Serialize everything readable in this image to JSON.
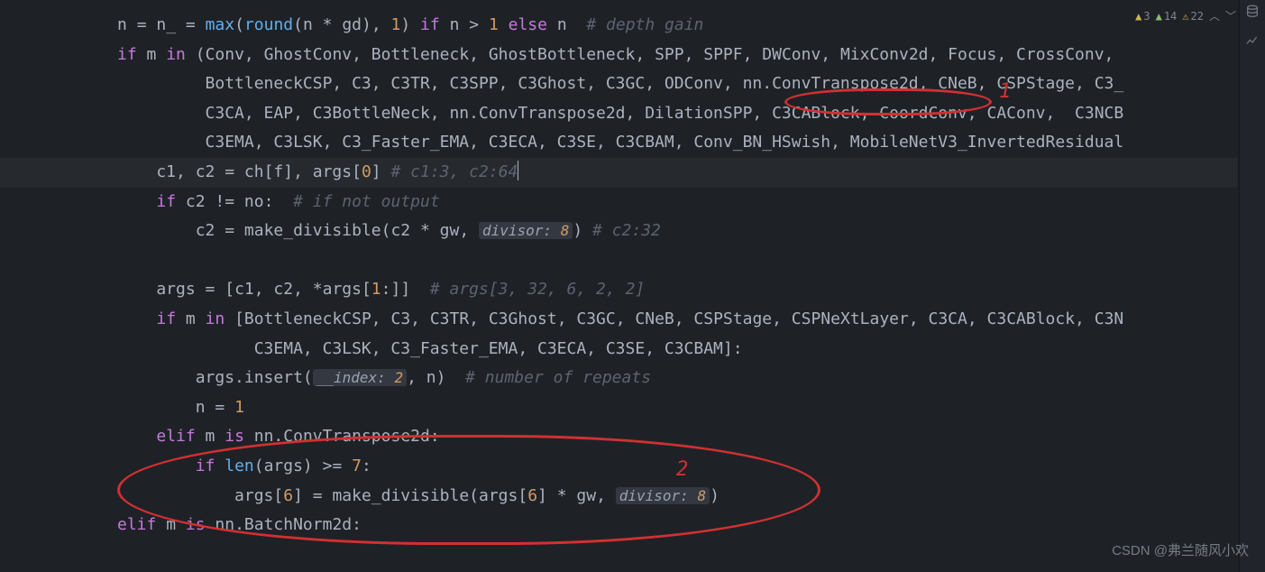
{
  "badges": {
    "err": "3",
    "warn": "14",
    "weak": "22"
  },
  "code": {
    "l1_a": "n ",
    "l1_b": "=",
    "l1_c": " n_ ",
    "l1_d": "=",
    "l1_e": " ",
    "l1_f": "max",
    "l1_g": "(",
    "l1_h": "round",
    "l1_i": "(n ",
    "l1_j": "*",
    "l1_k": " gd), ",
    "l1_l": "1",
    "l1_m": ") ",
    "l1_n": "if",
    "l1_o": " n ",
    "l1_p": ">",
    "l1_q": " ",
    "l1_r": "1",
    "l1_s": " ",
    "l1_t": "else",
    "l1_u": " n  ",
    "l1_v": "# depth gain",
    "l2_a": "if",
    "l2_b": " m ",
    "l2_c": "in",
    "l2_d": " (Conv, GhostConv, Bottleneck, GhostBottleneck, SPP, SPPF, DWConv, MixConv2d, Focus, CrossConv,",
    "l3_a": "         BottleneckCSP, C3, C3TR, C3SPP, C3Ghost, C3GC, ODConv, nn.ConvTranspose2d, CNeB, CSPStage, C3_",
    "l4_a": "         C3CA, EAP, C3BottleNeck, nn.ConvTranspose2d, DilationSPP, C3CABlock, CoordConv, CAConv,  C3NCB",
    "l5_a": "         C3EMA, C3LSK, C3_Faster_EMA, C3ECA, C3SE, C3CBAM, Conv_BN_HSwish, MobileNetV3_InvertedResidual",
    "l6_a": "    c1, c2 ",
    "l6_b": "=",
    "l6_c": " ch[f], args[",
    "l6_d": "0",
    "l6_e": "] ",
    "l6_f": "# c1:3, c2:64",
    "l7_a": "    ",
    "l7_b": "if",
    "l7_c": " c2 ",
    "l7_d": "!=",
    "l7_e": " no:  ",
    "l7_f": "# if not output",
    "l8_a": "        c2 ",
    "l8_b": "=",
    "l8_c": " make_divisible(c2 ",
    "l8_d": "*",
    "l8_e": " gw, ",
    "l8_hint": "divisor: ",
    "l8_hn": "8",
    "l8_f": ") ",
    "l8_g": "# c2:32",
    "l9": "",
    "l10_a": "    args ",
    "l10_b": "=",
    "l10_c": " [c1, c2, ",
    "l10_d": "*",
    "l10_e": "args[",
    "l10_f": "1",
    "l10_g": ":]]  ",
    "l10_h": "# args[3, 32, 6, 2, 2]",
    "l11_a": "    ",
    "l11_b": "if",
    "l11_c": " m ",
    "l11_d": "in",
    "l11_e": " [BottleneckCSP, C3, C3TR, C3Ghost, C3GC, CNeB, CSPStage, CSPNeXtLayer, C3CA, C3CABlock, C3N",
    "l12_a": "              C3EMA, C3LSK, C3_Faster_EMA, C3ECA, C3SE, C3CBAM]:",
    "l13_a": "        args.insert(",
    "l13_hint": "__index: ",
    "l13_hn": "2",
    "l13_b": ", n)  ",
    "l13_c": "# number of repeats",
    "l14_a": "        n ",
    "l14_b": "=",
    "l14_c": " ",
    "l14_d": "1",
    "l15_a": "    ",
    "l15_b": "elif",
    "l15_c": " m ",
    "l15_d": "is",
    "l15_e": " nn.ConvTranspose2d:",
    "l16_a": "        ",
    "l16_b": "if",
    "l16_c": " ",
    "l16_d": "len",
    "l16_e": "(args) ",
    "l16_f": ">=",
    "l16_g": " ",
    "l16_h": "7",
    "l16_i": ":",
    "l17_a": "            args[",
    "l17_b": "6",
    "l17_c": "] ",
    "l17_d": "=",
    "l17_e": " make_divisible(args[",
    "l17_f": "6",
    "l17_g": "] ",
    "l17_h": "*",
    "l17_i": " gw, ",
    "l17_hint": "divisor: ",
    "l17_hn": "8",
    "l17_j": ")",
    "l18_a": "elif",
    "l18_b": " m ",
    "l18_c": "is",
    "l18_d": " nn.BatchNorm2d:"
  },
  "annot": {
    "label1": "1",
    "label2": "2"
  },
  "watermark": "CSDN @弗兰随风小欢"
}
